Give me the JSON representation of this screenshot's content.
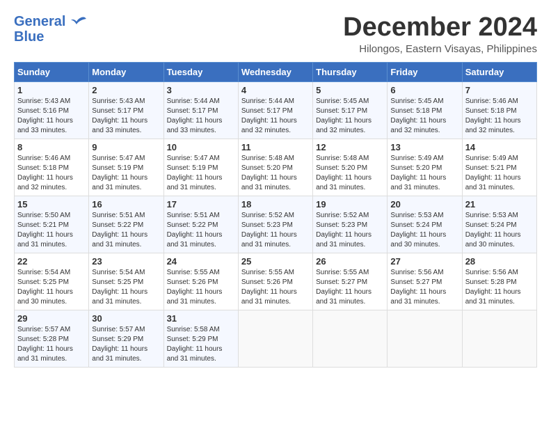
{
  "logo": {
    "line1": "General",
    "line2": "Blue"
  },
  "title": "December 2024",
  "location": "Hilongos, Eastern Visayas, Philippines",
  "weekdays": [
    "Sunday",
    "Monday",
    "Tuesday",
    "Wednesday",
    "Thursday",
    "Friday",
    "Saturday"
  ],
  "weeks": [
    [
      {
        "day": "1",
        "info": "Sunrise: 5:43 AM\nSunset: 5:16 PM\nDaylight: 11 hours\nand 33 minutes."
      },
      {
        "day": "2",
        "info": "Sunrise: 5:43 AM\nSunset: 5:17 PM\nDaylight: 11 hours\nand 33 minutes."
      },
      {
        "day": "3",
        "info": "Sunrise: 5:44 AM\nSunset: 5:17 PM\nDaylight: 11 hours\nand 33 minutes."
      },
      {
        "day": "4",
        "info": "Sunrise: 5:44 AM\nSunset: 5:17 PM\nDaylight: 11 hours\nand 32 minutes."
      },
      {
        "day": "5",
        "info": "Sunrise: 5:45 AM\nSunset: 5:17 PM\nDaylight: 11 hours\nand 32 minutes."
      },
      {
        "day": "6",
        "info": "Sunrise: 5:45 AM\nSunset: 5:18 PM\nDaylight: 11 hours\nand 32 minutes."
      },
      {
        "day": "7",
        "info": "Sunrise: 5:46 AM\nSunset: 5:18 PM\nDaylight: 11 hours\nand 32 minutes."
      }
    ],
    [
      {
        "day": "8",
        "info": "Sunrise: 5:46 AM\nSunset: 5:18 PM\nDaylight: 11 hours\nand 32 minutes."
      },
      {
        "day": "9",
        "info": "Sunrise: 5:47 AM\nSunset: 5:19 PM\nDaylight: 11 hours\nand 31 minutes."
      },
      {
        "day": "10",
        "info": "Sunrise: 5:47 AM\nSunset: 5:19 PM\nDaylight: 11 hours\nand 31 minutes."
      },
      {
        "day": "11",
        "info": "Sunrise: 5:48 AM\nSunset: 5:20 PM\nDaylight: 11 hours\nand 31 minutes."
      },
      {
        "day": "12",
        "info": "Sunrise: 5:48 AM\nSunset: 5:20 PM\nDaylight: 11 hours\nand 31 minutes."
      },
      {
        "day": "13",
        "info": "Sunrise: 5:49 AM\nSunset: 5:20 PM\nDaylight: 11 hours\nand 31 minutes."
      },
      {
        "day": "14",
        "info": "Sunrise: 5:49 AM\nSunset: 5:21 PM\nDaylight: 11 hours\nand 31 minutes."
      }
    ],
    [
      {
        "day": "15",
        "info": "Sunrise: 5:50 AM\nSunset: 5:21 PM\nDaylight: 11 hours\nand 31 minutes."
      },
      {
        "day": "16",
        "info": "Sunrise: 5:51 AM\nSunset: 5:22 PM\nDaylight: 11 hours\nand 31 minutes."
      },
      {
        "day": "17",
        "info": "Sunrise: 5:51 AM\nSunset: 5:22 PM\nDaylight: 11 hours\nand 31 minutes."
      },
      {
        "day": "18",
        "info": "Sunrise: 5:52 AM\nSunset: 5:23 PM\nDaylight: 11 hours\nand 31 minutes."
      },
      {
        "day": "19",
        "info": "Sunrise: 5:52 AM\nSunset: 5:23 PM\nDaylight: 11 hours\nand 31 minutes."
      },
      {
        "day": "20",
        "info": "Sunrise: 5:53 AM\nSunset: 5:24 PM\nDaylight: 11 hours\nand 30 minutes."
      },
      {
        "day": "21",
        "info": "Sunrise: 5:53 AM\nSunset: 5:24 PM\nDaylight: 11 hours\nand 30 minutes."
      }
    ],
    [
      {
        "day": "22",
        "info": "Sunrise: 5:54 AM\nSunset: 5:25 PM\nDaylight: 11 hours\nand 30 minutes."
      },
      {
        "day": "23",
        "info": "Sunrise: 5:54 AM\nSunset: 5:25 PM\nDaylight: 11 hours\nand 31 minutes."
      },
      {
        "day": "24",
        "info": "Sunrise: 5:55 AM\nSunset: 5:26 PM\nDaylight: 11 hours\nand 31 minutes."
      },
      {
        "day": "25",
        "info": "Sunrise: 5:55 AM\nSunset: 5:26 PM\nDaylight: 11 hours\nand 31 minutes."
      },
      {
        "day": "26",
        "info": "Sunrise: 5:55 AM\nSunset: 5:27 PM\nDaylight: 11 hours\nand 31 minutes."
      },
      {
        "day": "27",
        "info": "Sunrise: 5:56 AM\nSunset: 5:27 PM\nDaylight: 11 hours\nand 31 minutes."
      },
      {
        "day": "28",
        "info": "Sunrise: 5:56 AM\nSunset: 5:28 PM\nDaylight: 11 hours\nand 31 minutes."
      }
    ],
    [
      {
        "day": "29",
        "info": "Sunrise: 5:57 AM\nSunset: 5:28 PM\nDaylight: 11 hours\nand 31 minutes."
      },
      {
        "day": "30",
        "info": "Sunrise: 5:57 AM\nSunset: 5:29 PM\nDaylight: 11 hours\nand 31 minutes."
      },
      {
        "day": "31",
        "info": "Sunrise: 5:58 AM\nSunset: 5:29 PM\nDaylight: 11 hours\nand 31 minutes."
      },
      {
        "day": "",
        "info": ""
      },
      {
        "day": "",
        "info": ""
      },
      {
        "day": "",
        "info": ""
      },
      {
        "day": "",
        "info": ""
      }
    ]
  ]
}
